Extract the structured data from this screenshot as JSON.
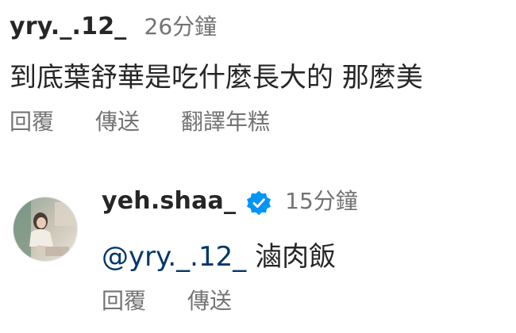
{
  "comments": [
    {
      "username": "yry._.12_",
      "timestamp": "26分鐘",
      "text": "到底葉舒華是吃什麼長大的 那麼美",
      "actions": {
        "reply": "回覆",
        "share": "傳送",
        "translate": "翻譯年糕"
      }
    },
    {
      "username": "yeh.shaa_",
      "verified": true,
      "timestamp": "15分鐘",
      "mention": "@yry._.12_",
      "text": "滷肉飯",
      "actions": {
        "reply": "回覆",
        "share": "傳送"
      }
    }
  ],
  "colors": {
    "username": "#262626",
    "muted": "#737373",
    "mention": "#00376b",
    "verified_badge": "#0095f6"
  },
  "icons": {
    "verified": "verified-badge-icon",
    "avatar": "profile-photo"
  }
}
